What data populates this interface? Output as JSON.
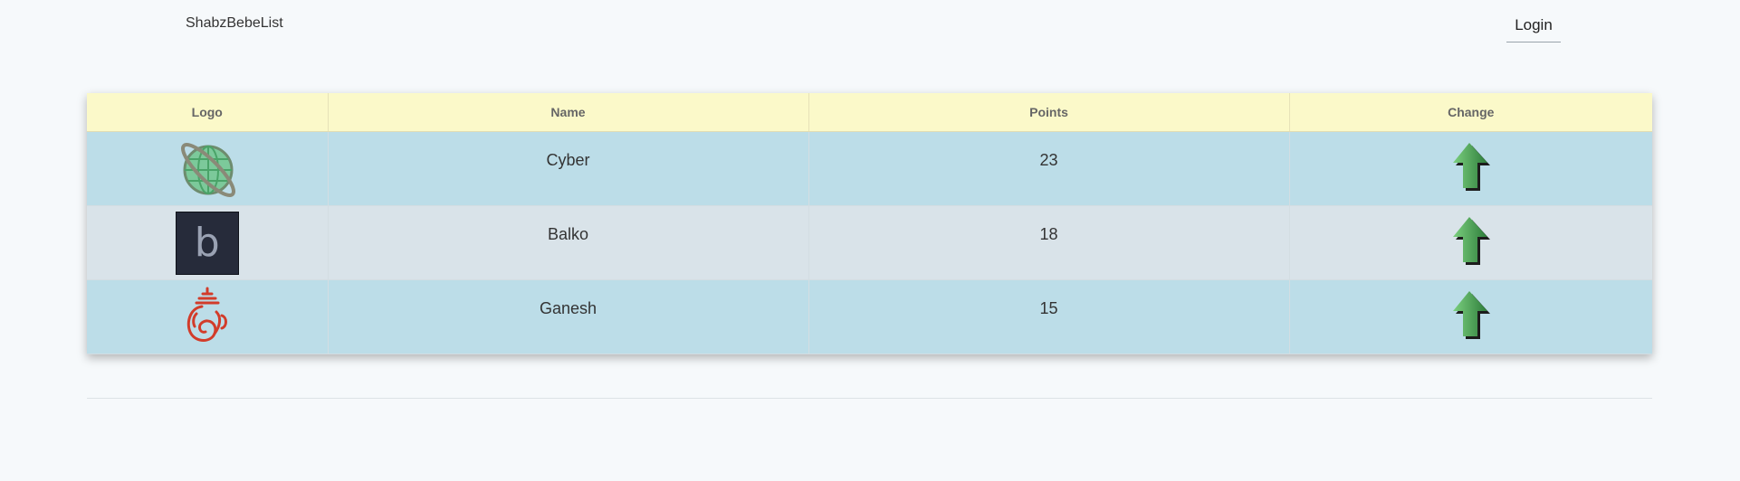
{
  "header": {
    "brand": "ShabzBebeList",
    "login_label": "Login"
  },
  "table": {
    "columns": [
      "Logo",
      "Name",
      "Points",
      "Change"
    ],
    "rows": [
      {
        "name": "Cyber",
        "points": "23",
        "logo": "globe-icon",
        "change": "arrow-up-icon"
      },
      {
        "name": "Balko",
        "points": "18",
        "logo": "balko-b-logo",
        "logo_text": "b",
        "change": "arrow-up-icon"
      },
      {
        "name": "Ganesh",
        "points": "15",
        "logo": "ganesh-icon",
        "change": "arrow-up-icon"
      }
    ]
  },
  "colors": {
    "header_bg": "#fbf9c9",
    "row_odd": "#bcdde8",
    "row_even": "#d9e3e9",
    "arrow_green": "#3f9a4d"
  }
}
